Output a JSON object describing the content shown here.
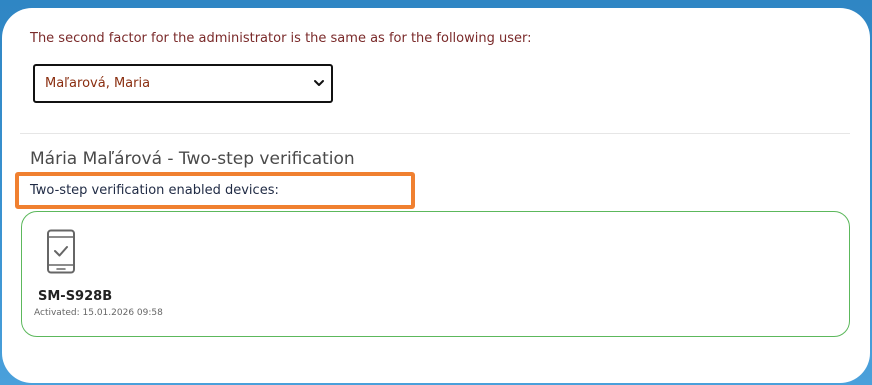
{
  "intro_text": "The second factor for the administrator is the same as for the following user:",
  "user_select": {
    "selected": "Maľarová, Maria"
  },
  "section_title": "Mária Maľárová - Two-step verification",
  "devices_label": "Two-step verification enabled devices:",
  "devices": [
    {
      "name": "SM-S928B",
      "activated_label": "Activated:",
      "activated_value": "15.01.2026 09:58",
      "icon": "phone-check-icon"
    }
  ],
  "colors": {
    "intro_text": "#7a2a2a",
    "select_value": "#8a2e10",
    "highlight": "#f08030",
    "device_border": "#5cb85c",
    "backdrop": "#3b93d1"
  }
}
